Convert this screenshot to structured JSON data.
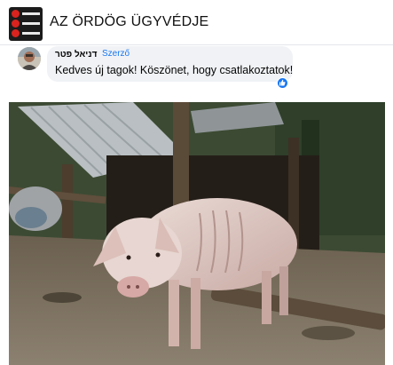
{
  "group": {
    "title": "AZ ÖRDÖG ÜGYVÉDJE",
    "logo_icon": "group-logo-icon"
  },
  "comment": {
    "author": "דניאל פטר",
    "badge": "Szerző",
    "text": "Kedves új tagok! Köszönet, hogy csatlakoztatok!",
    "reaction_icon": "like-icon"
  },
  "post": {
    "image_icon": "pig-photo"
  },
  "colors": {
    "accent": "#1877f2",
    "bubble": "#f0f2f5",
    "logo_red": "#d9231e",
    "logo_bg": "#1b1b1b"
  }
}
